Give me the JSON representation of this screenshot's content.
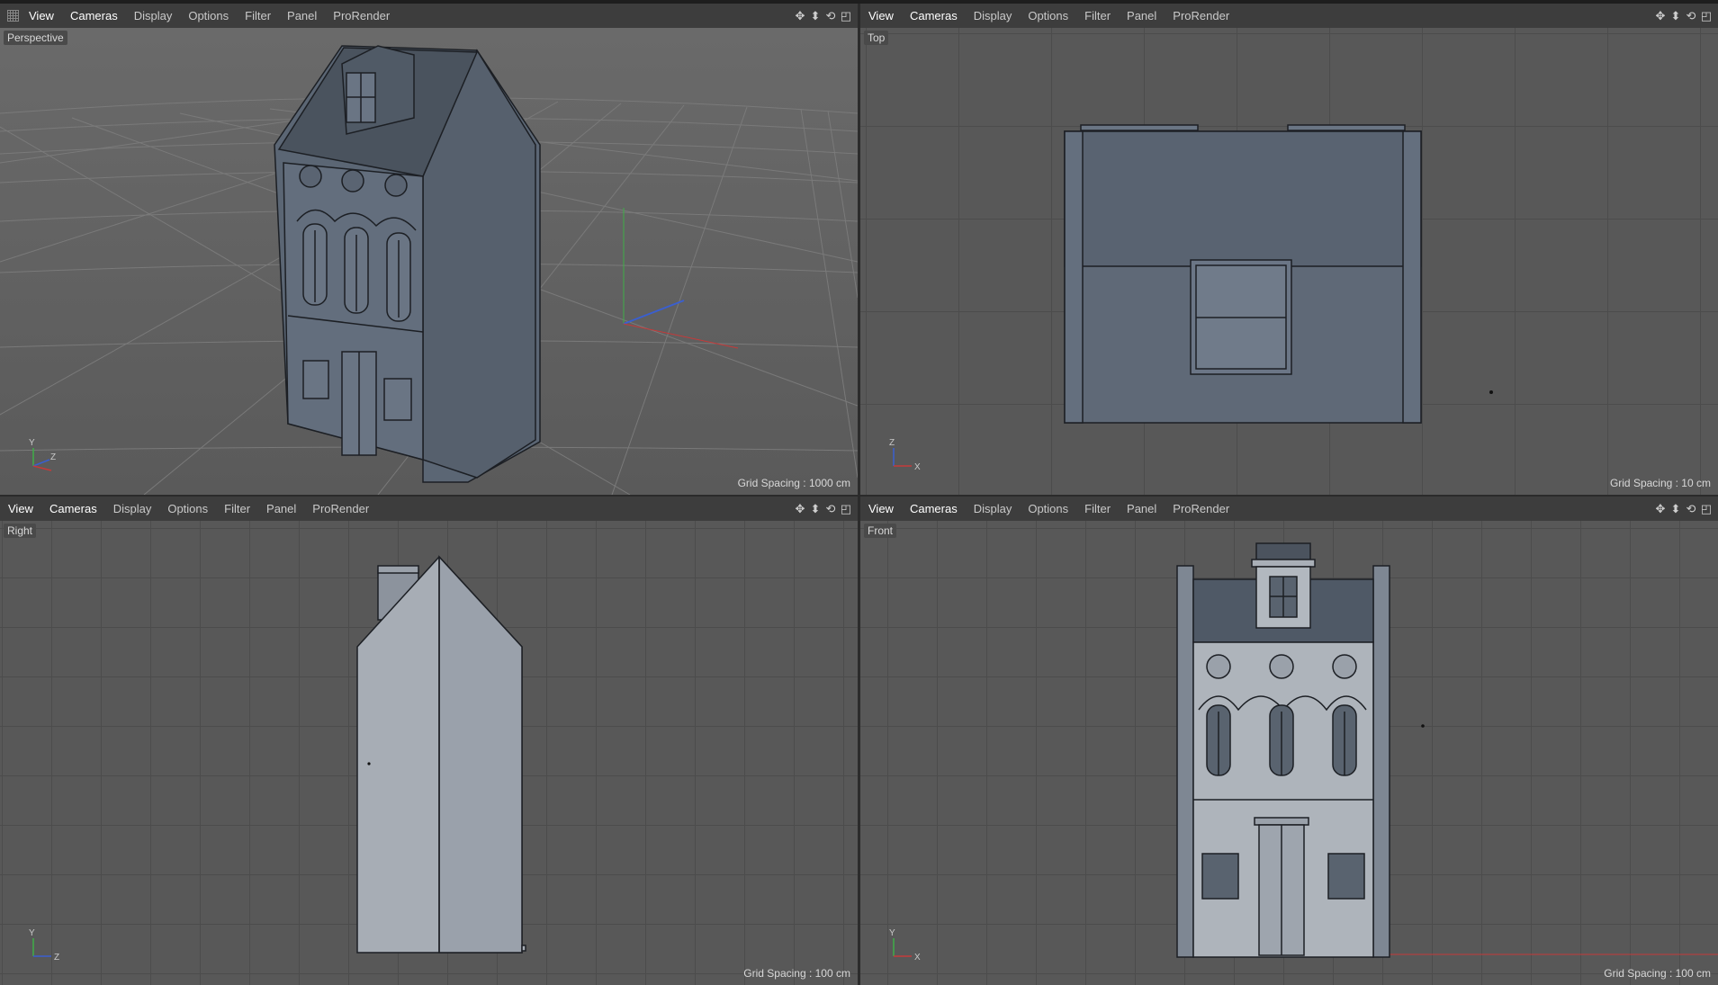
{
  "menu": [
    "View",
    "Cameras",
    "Display",
    "Options",
    "Filter",
    "Panel",
    "ProRender"
  ],
  "nav_icons": [
    "move-view-icon",
    "dolly-view-icon",
    "rotate-view-icon",
    "maximize-view-icon"
  ],
  "viewports": {
    "perspective": {
      "label": "Perspective",
      "grid_spacing": "Grid Spacing : 1000 cm"
    },
    "top": {
      "label": "Top",
      "grid_spacing": "Grid Spacing : 10 cm"
    },
    "right": {
      "label": "Right",
      "grid_spacing": "Grid Spacing : 100 cm"
    },
    "front": {
      "label": "Front",
      "grid_spacing": "Grid Spacing : 100 cm"
    }
  },
  "axis": {
    "x": "X",
    "y": "Y",
    "z": "Z"
  },
  "colors": {
    "viewport_bg": "#5c5c5c",
    "menubar_bg": "#3d3d3d",
    "model": "#606c7b",
    "axis_x": "#c53a3a",
    "axis_y": "#3fae47",
    "axis_z": "#3a5fd0"
  }
}
